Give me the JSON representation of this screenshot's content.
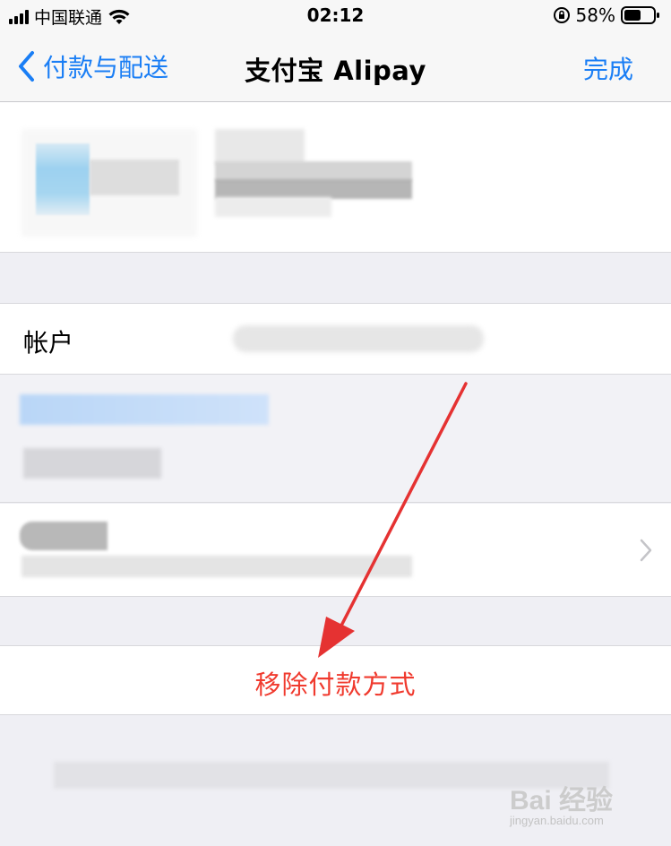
{
  "status_bar": {
    "carrier": "中国联通",
    "time": "02:12",
    "battery_percent": "58%",
    "battery_level": 0.58
  },
  "nav": {
    "back_label": "付款与配送",
    "title": "支付宝 Alipay",
    "done_label": "完成"
  },
  "account": {
    "label": "帐户"
  },
  "actions": {
    "remove_label": "移除付款方式"
  },
  "watermark": {
    "logo": "Bai 经验",
    "url": "jingyan.baidu.com"
  },
  "colors": {
    "accent_blue": "#1a7ef5",
    "destructive_red": "#f03a2e",
    "annotation_red": "#e53232"
  }
}
